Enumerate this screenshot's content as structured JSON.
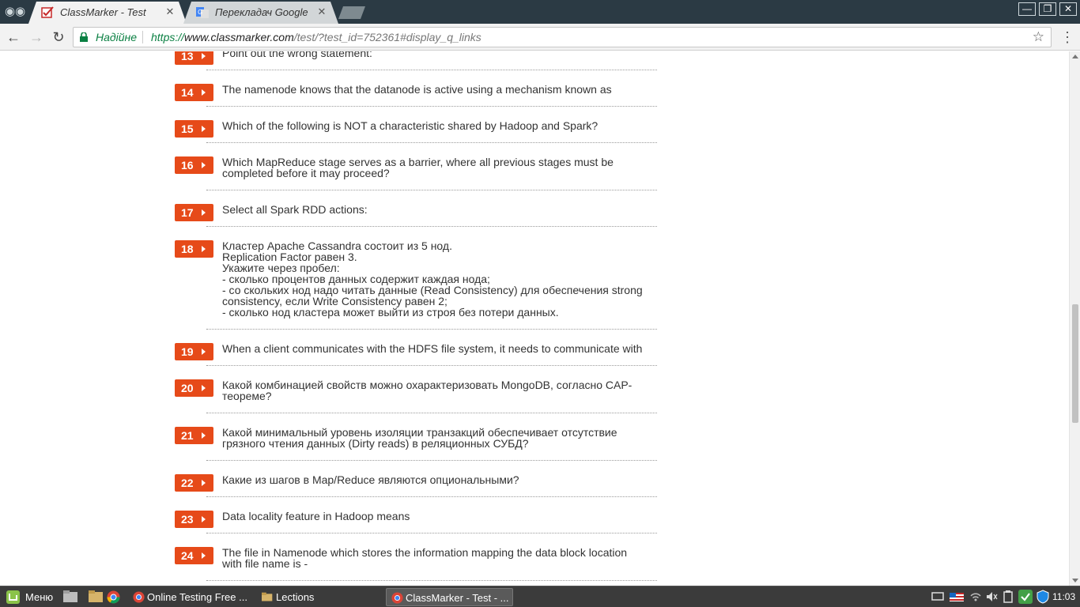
{
  "browser": {
    "tabs": [
      {
        "title": "ClassMarker - Test",
        "active": true
      },
      {
        "title": "Перекладач Google",
        "active": false
      }
    ],
    "address": {
      "security_label": "Надійне",
      "url_scheme": "https://",
      "url_host": "www.classmarker.com",
      "url_rest": "/test/?test_id=752361#display_q_links"
    }
  },
  "questions": [
    {
      "number": "13",
      "lines": [
        "Point out the wrong statement:"
      ]
    },
    {
      "number": "14",
      "lines": [
        "The namenode knows that the datanode is active using a mechanism known as"
      ]
    },
    {
      "number": "15",
      "lines": [
        "Which of the following is NOT a characteristic shared by Hadoop and Spark?"
      ]
    },
    {
      "number": "16",
      "lines": [
        "Which MapReduce stage serves as a barrier, where all previous stages must be",
        "completed before it may proceed?"
      ]
    },
    {
      "number": "17",
      "lines": [
        "Select all Spark RDD actions:"
      ]
    },
    {
      "number": "18",
      "lines": [
        "Кластер Apache Cassandra состоит из 5 нод.",
        "Replication Factor равен 3.",
        "Укажите через пробел:",
        "- сколько процентов данных содержит каждая нода;",
        "- со скольких нод надо читать данные (Read Consistency) для обеспечения strong",
        "consistency, если Write Consistency равен 2;",
        "- сколько нод кластера может выйти из строя без потери данных."
      ]
    },
    {
      "number": "19",
      "lines": [
        "When a client communicates with the HDFS file system, it needs to communicate with"
      ]
    },
    {
      "number": "20",
      "lines": [
        "Какой комбинацией свойств можно охарактеризовать MongoDB, согласно CAP-",
        "теореме?"
      ]
    },
    {
      "number": "21",
      "lines": [
        "Какой минимальный уровень изоляции транзакций обеспечивает отсутствие",
        "грязного чтения данных (Dirty reads) в реляционных СУБД?"
      ]
    },
    {
      "number": "22",
      "lines": [
        "Какие из шагов в Map/Reduce являются опциональными?"
      ]
    },
    {
      "number": "23",
      "lines": [
        "Data locality feature in Hadoop means"
      ]
    },
    {
      "number": "24",
      "lines": [
        "The file in Namenode which stores the information mapping the data block location",
        "with file name is -"
      ]
    }
  ],
  "taskbar": {
    "menu_label": "Меню",
    "windows": [
      {
        "label": "Online Testing Free ...",
        "icon": "chrome-icon",
        "active": false
      },
      {
        "label": "Lections",
        "icon": "folder-icon",
        "active": false
      },
      {
        "label": "ClassMarker - Test - ...",
        "icon": "chrome-icon",
        "active": true
      }
    ],
    "clock": "11:03"
  },
  "colors": {
    "badge": "#e64a19",
    "secure": "#0b8043",
    "titlebar": "#2b3a44",
    "taskbar": "#3b3b3b"
  }
}
